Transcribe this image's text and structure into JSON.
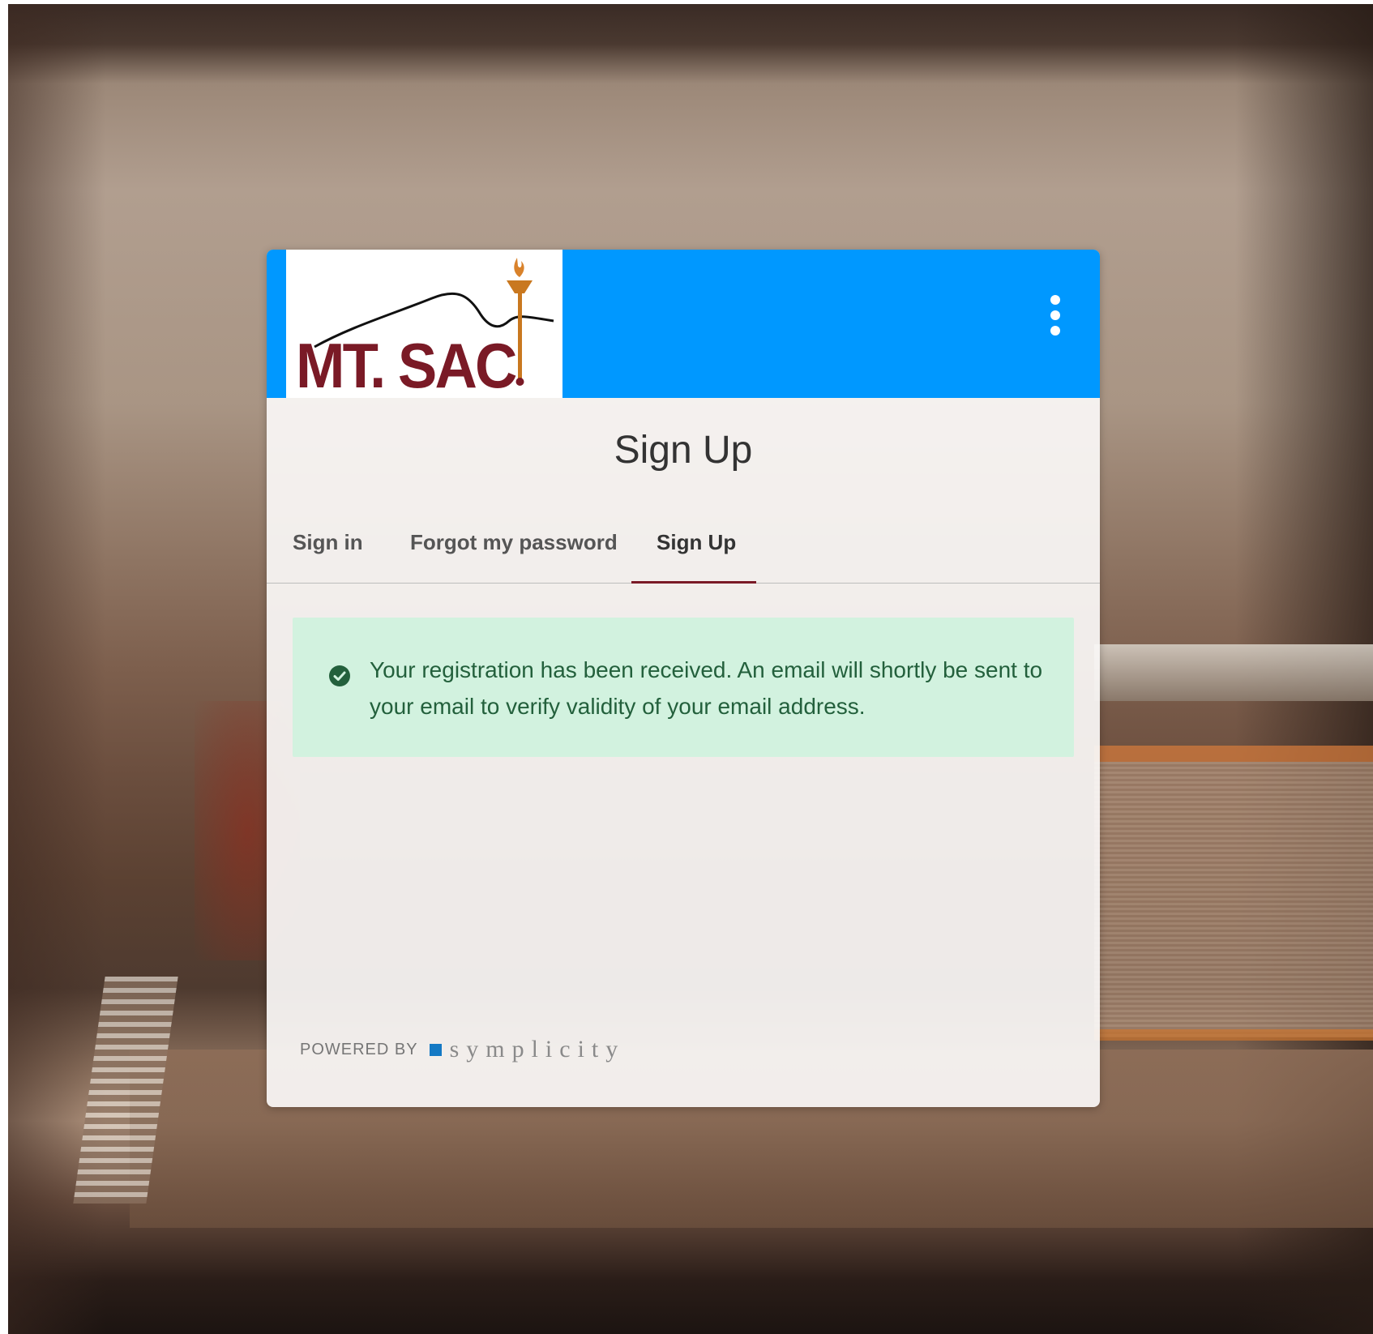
{
  "header": {
    "logo_text": "MT. SAC",
    "menu_icon": "more-vertical-icon",
    "brand_color": "#0098ff",
    "logo_color": "#7a1a26"
  },
  "main": {
    "title": "Sign Up",
    "tabs": [
      {
        "label": "Sign in",
        "active": false
      },
      {
        "label": "Forgot my password",
        "active": false
      },
      {
        "label": "Sign Up",
        "active": true
      }
    ],
    "alert": {
      "icon": "check-circle-icon",
      "message": "Your registration has been received. An email will shortly be sent to your email to verify validity of your email address.",
      "status_color": "#23603c"
    }
  },
  "footer": {
    "powered_by": "POWERED BY",
    "brand": "symplicity"
  }
}
